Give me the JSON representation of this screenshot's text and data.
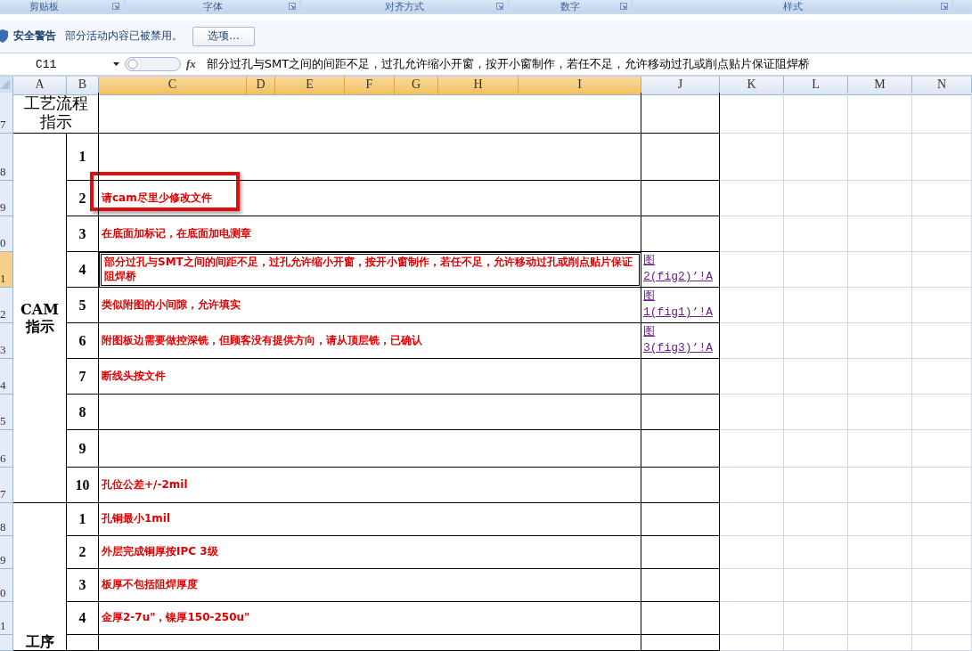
{
  "ribbon_groups": [
    "剪贴板",
    "字体",
    "对齐方式",
    "数字",
    "样式"
  ],
  "security_bar": {
    "title": "安全警告",
    "message": "部分活动内容已被禁用。",
    "button": "选项..."
  },
  "formula_bar": {
    "name_box": "C11",
    "fx": "fx",
    "formula": "部分过孔与SMT之间的间距不足，过孔允许缩小开窗，按开小窗制作，若任不足，允许移动过孔或削点贴片保证阻焊桥"
  },
  "columns": [
    {
      "label": "A",
      "selected": false
    },
    {
      "label": "B",
      "selected": false
    },
    {
      "label": "C",
      "selected": true
    },
    {
      "label": "D",
      "selected": true
    },
    {
      "label": "E",
      "selected": true
    },
    {
      "label": "F",
      "selected": true
    },
    {
      "label": "G",
      "selected": true
    },
    {
      "label": "H",
      "selected": true
    },
    {
      "label": "I",
      "selected": true
    },
    {
      "label": "J",
      "selected": false
    },
    {
      "label": "K",
      "selected": false
    },
    {
      "label": "L",
      "selected": false
    },
    {
      "label": "M",
      "selected": false
    },
    {
      "label": "N",
      "selected": false
    }
  ],
  "rows": [
    {
      "label": "7",
      "selected": false
    },
    {
      "label": "8",
      "selected": false
    },
    {
      "label": "9",
      "selected": false
    },
    {
      "label": "0",
      "selected": false
    },
    {
      "label": "1",
      "selected": true
    },
    {
      "label": "2",
      "selected": false
    },
    {
      "label": "3",
      "selected": false
    },
    {
      "label": "4",
      "selected": false
    },
    {
      "label": "5",
      "selected": false
    },
    {
      "label": "6",
      "selected": false
    },
    {
      "label": "7",
      "selected": false
    },
    {
      "label": "8",
      "selected": false
    },
    {
      "label": "9",
      "selected": false
    },
    {
      "label": "0",
      "selected": false
    },
    {
      "label": "1",
      "selected": false
    }
  ],
  "table": {
    "heading": "工艺流程指示",
    "sections": [
      {
        "title": "CAM指示",
        "items": [
          {
            "no": "1",
            "highlighted": false
          },
          {
            "no": "2",
            "text": "请cam尽里少修改文件",
            "highlighted": true
          },
          {
            "no": "3",
            "text": "在底面加标记，在底面加电测章",
            "highlighted": false
          },
          {
            "no": "4",
            "text": "部分过孔与SMT之间的间距不足，过孔允许缩小开窗，按开小窗制作，若任不足，允许移动过孔或削点贴片保证阻焊桥",
            "link": "图\n2(fig2)’!A",
            "highlighted": false
          },
          {
            "no": "5",
            "text": "类似附图的小间隙，允许填实",
            "link": "图\n1(fig1)’!A",
            "highlighted": false
          },
          {
            "no": "6",
            "text": "附图板边需要做控深铣，但顾客没有提供方向，请从顶层铣，已确认",
            "link": "图\n3(fig3)’!A",
            "highlighted": false
          },
          {
            "no": "7",
            "text": "断线头按文件",
            "highlighted": false
          },
          {
            "no": "8",
            "highlighted": false
          },
          {
            "no": "9",
            "highlighted": false
          },
          {
            "no": "10",
            "text": "孔位公差+/-2mil",
            "highlighted": false
          }
        ]
      },
      {
        "title": "工序",
        "items": [
          {
            "no": "1",
            "text": "孔铜最小1mil",
            "highlighted": false
          },
          {
            "no": "2",
            "text": "外层完成铜厚按IPC 3级",
            "highlighted": false
          },
          {
            "no": "3",
            "text": "板厚不包括阻焊厚度",
            "highlighted": false
          },
          {
            "no": "4",
            "text": "金厚2-7u\"，镍厚150-250u\"",
            "highlighted": false
          }
        ]
      }
    ]
  }
}
